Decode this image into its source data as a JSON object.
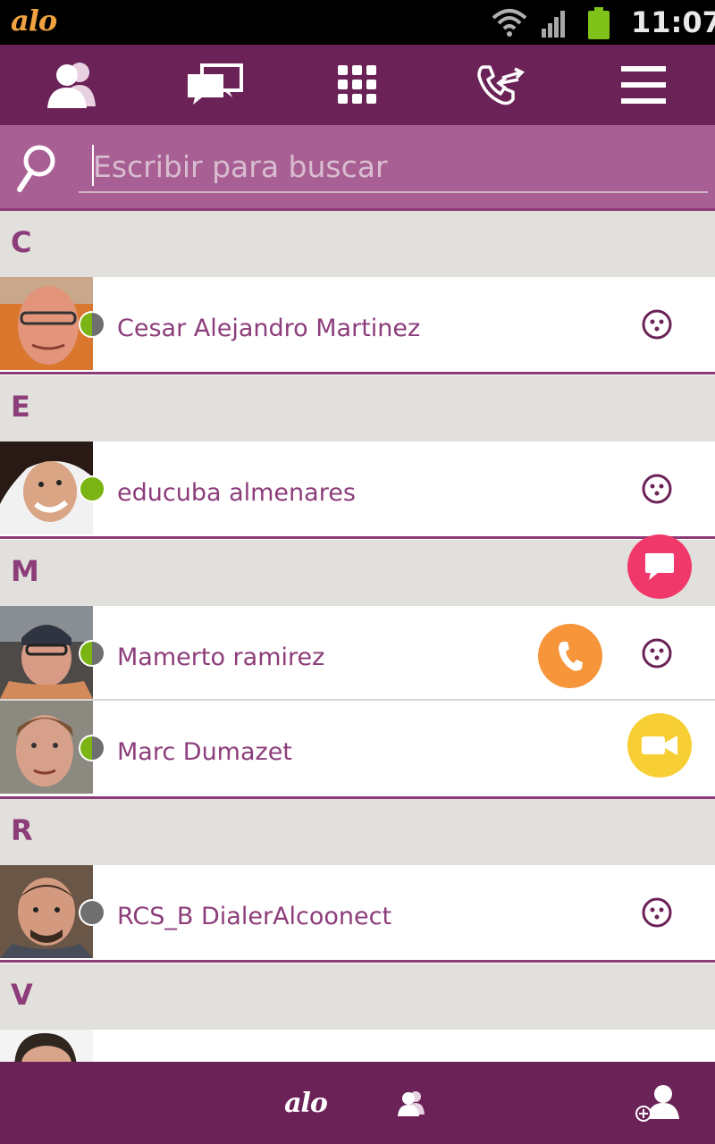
{
  "status_bar": {
    "app_logo": "alo",
    "time": "11:07",
    "icons": [
      "wifi-icon",
      "signal-icon",
      "battery-icon"
    ]
  },
  "top_nav": {
    "items": [
      {
        "icon": "contacts-icon",
        "active": true
      },
      {
        "icon": "chat-icon",
        "active": false
      },
      {
        "icon": "dialpad-icon",
        "active": false
      },
      {
        "icon": "call-history-icon",
        "active": false
      },
      {
        "icon": "menu-icon",
        "active": false
      }
    ]
  },
  "search": {
    "placeholder": "Escribir para buscar",
    "value": ""
  },
  "sections": [
    {
      "letter": "C",
      "contacts": [
        {
          "name": "Cesar Alejandro Martinez",
          "presence": "split-green-gray"
        }
      ]
    },
    {
      "letter": "E",
      "contacts": [
        {
          "name": "educuba almenares",
          "presence": "online-green"
        }
      ]
    },
    {
      "letter": "M",
      "contacts": [
        {
          "name": "Mamerto ramirez",
          "presence": "split-green-gray"
        },
        {
          "name": "Marc Dumazet",
          "presence": "split-green-gray"
        }
      ]
    },
    {
      "letter": "R",
      "contacts": [
        {
          "name": "RCS_B DialerAlcoonect",
          "presence": "offline-gray"
        }
      ]
    },
    {
      "letter": "V",
      "contacts": [
        {
          "name": "",
          "presence": ""
        }
      ]
    }
  ],
  "quick_actions": [
    {
      "icon": "message-icon",
      "color": "#f0386b"
    },
    {
      "icon": "phone-icon",
      "color": "#f7953a"
    },
    {
      "icon": "video-icon",
      "color": "#f7cf34"
    }
  ],
  "bottom_nav": {
    "logo": "alo",
    "icons": [
      "contacts-group-icon",
      "add-contact-icon"
    ]
  },
  "colors": {
    "brand_purple": "#6b2257",
    "search_purple": "#a85f93",
    "text_purple": "#8c3d7a",
    "presence_green": "#7bb414",
    "presence_gray": "#6f6f6f"
  }
}
